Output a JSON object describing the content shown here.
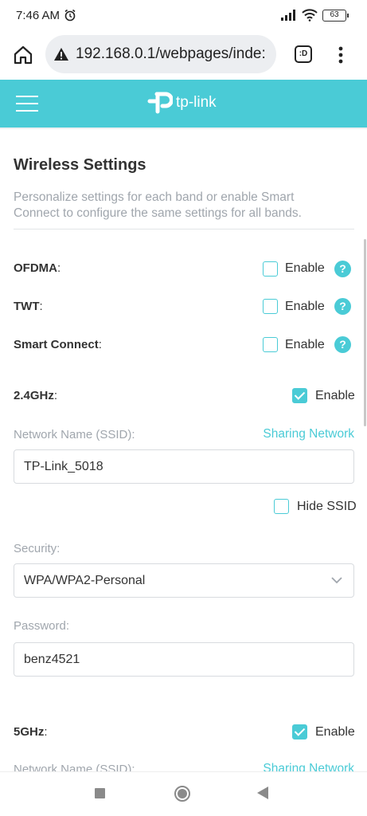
{
  "status": {
    "time": "7:46 AM",
    "battery": "63"
  },
  "browser": {
    "url": "192.168.0.1/webpages/inde:",
    "tab_count": ":D"
  },
  "brand": {
    "logo_text": "tp-link",
    "accent": "#4acbd6"
  },
  "page": {
    "title": "Wireless Settings",
    "description": "Personalize settings for each band or enable Smart Connect to configure the same settings for all bands."
  },
  "options": [
    {
      "label": "OFDMA",
      "check_label": "Enable",
      "checked": false
    },
    {
      "label": "TWT",
      "check_label": "Enable",
      "checked": false
    },
    {
      "label": "Smart Connect",
      "check_label": "Enable",
      "checked": false
    }
  ],
  "band24": {
    "label": "2.4GHz",
    "enable_label": "Enable",
    "enabled": true,
    "ssid_label": "Network Name (SSID):",
    "sharing_link": "Sharing Network",
    "ssid_value": "TP-Link_5018",
    "hide_ssid_label": "Hide SSID",
    "hide_ssid": false,
    "security_label": "Security:",
    "security_value": "WPA/WPA2-Personal",
    "password_label": "Password:",
    "password_value": "benz4521"
  },
  "band5": {
    "label": "5GHz",
    "enable_label": "Enable",
    "enabled": true,
    "ssid_label": "Network Name (SSID):",
    "sharing_link": "Sharing Network"
  },
  "colon": ":"
}
